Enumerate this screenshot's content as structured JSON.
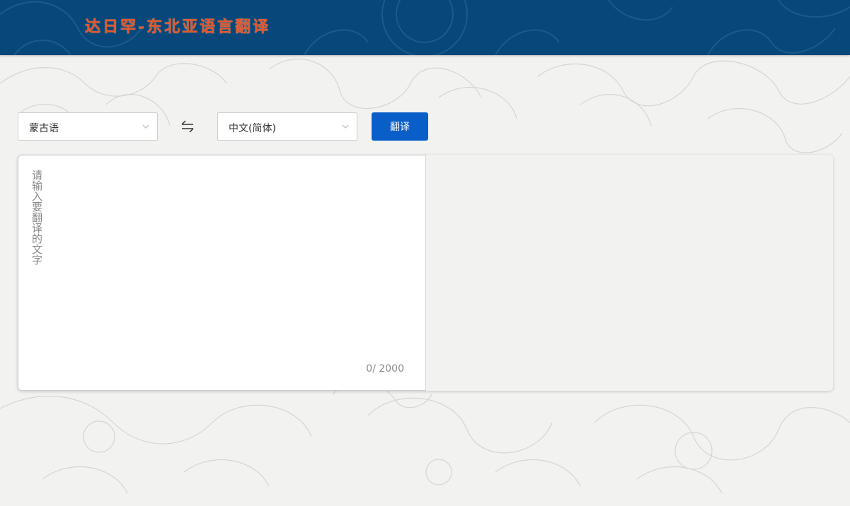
{
  "header": {
    "title": "达日罕-东北亚语言翻译",
    "title_color": "#e2562a",
    "background": "#07477a"
  },
  "toolbar": {
    "source_language": "蒙古语",
    "target_language": "中文(简体)",
    "swap_icon": "swap-arrows-icon",
    "translate_label": "翻译",
    "accent": "#0a5ec8"
  },
  "input": {
    "placeholder": "请输入要翻译的文字",
    "value": "",
    "counter": "0/ 2000"
  },
  "output": {
    "text": ""
  }
}
